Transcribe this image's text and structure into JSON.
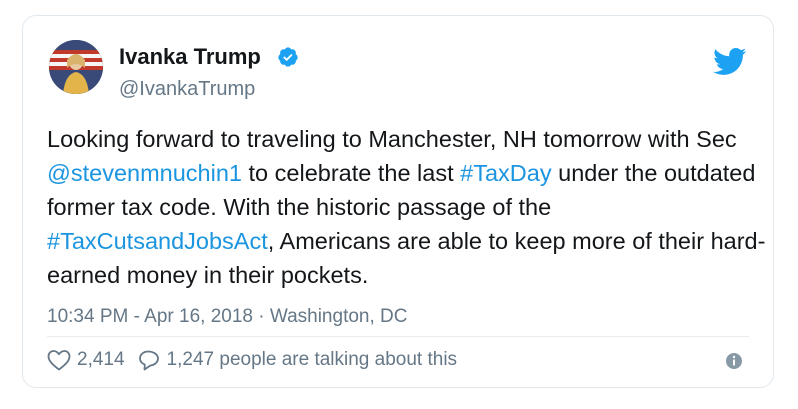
{
  "tweet": {
    "author_name": "Ivanka Trump",
    "handle": "@IvankaTrump",
    "text_parts": {
      "p1": "Looking forward to traveling to Manchester, NH tomorrow with Sec ",
      "mention": "@stevenmnuchin1",
      "p2": " to celebrate the last ",
      "hashtag1": "#TaxDay",
      "p3": " under the outdated former tax code. With the historic passage of the ",
      "hashtag2": "#TaxCutsandJobsAct",
      "p4": ", Americans are able to keep more of their hard-earned money in their pockets."
    },
    "timestamp": "10:34 PM - Apr 16, 2018 · Washington, DC",
    "likes": "2,414",
    "replies_label": "1,247 people are talking about this"
  },
  "colors": {
    "link": "#1b95e0",
    "muted": "#657786",
    "verified": "#1da1f2"
  },
  "icons": [
    "verified-badge-icon",
    "twitter-bird-icon",
    "heart-icon",
    "reply-bubble-icon",
    "info-icon"
  ]
}
